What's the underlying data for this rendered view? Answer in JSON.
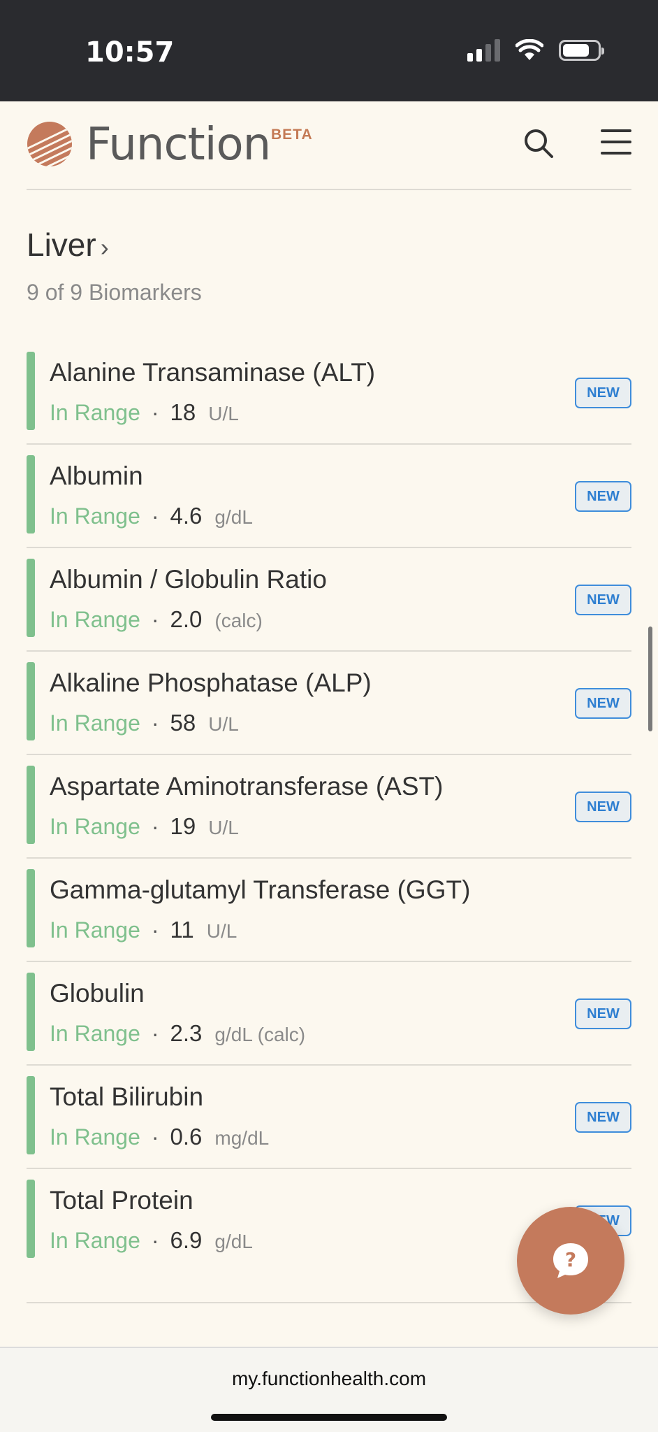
{
  "status_bar": {
    "time": "10:57"
  },
  "header": {
    "brand": "Function",
    "beta": "BETA",
    "logo_icon": "function-logo-icon",
    "search_icon": "search-icon",
    "menu_icon": "hamburger-menu-icon"
  },
  "section": {
    "title": "Liver",
    "chevron": "›",
    "subtitle": "9 of 9 Biomarkers"
  },
  "biomarkers": [
    {
      "name": "Alanine Transaminase (ALT)",
      "status": "In Range",
      "value": "18",
      "unit": "U/L",
      "badge": "NEW"
    },
    {
      "name": "Albumin",
      "status": "In Range",
      "value": "4.6",
      "unit": "g/dL",
      "badge": "NEW"
    },
    {
      "name": "Albumin / Globulin Ratio",
      "status": "In Range",
      "value": "2.0",
      "unit": "(calc)",
      "badge": "NEW"
    },
    {
      "name": "Alkaline Phosphatase (ALP)",
      "status": "In Range",
      "value": "58",
      "unit": "U/L",
      "badge": "NEW"
    },
    {
      "name": "Aspartate Aminotransferase (AST)",
      "status": "In Range",
      "value": "19",
      "unit": "U/L",
      "badge": "NEW"
    },
    {
      "name": "Gamma-glutamyl Transferase (GGT)",
      "status": "In Range",
      "value": "11",
      "unit": "U/L",
      "badge": ""
    },
    {
      "name": "Globulin",
      "status": "In Range",
      "value": "2.3",
      "unit": "g/dL (calc)",
      "badge": "NEW"
    },
    {
      "name": "Total Bilirubin",
      "status": "In Range",
      "value": "0.6",
      "unit": "mg/dL",
      "badge": "NEW"
    },
    {
      "name": "Total Protein",
      "status": "In Range",
      "value": "6.9",
      "unit": "g/dL",
      "badge": "NEW"
    }
  ],
  "separator": "·",
  "help_button": {
    "icon": "help-question-icon"
  },
  "browser": {
    "url": "my.functionhealth.com"
  },
  "colors": {
    "in_range": "#7fc08d",
    "brand": "#c47a5c",
    "badge": "#2f7fd1",
    "background": "#fcf8ef"
  }
}
